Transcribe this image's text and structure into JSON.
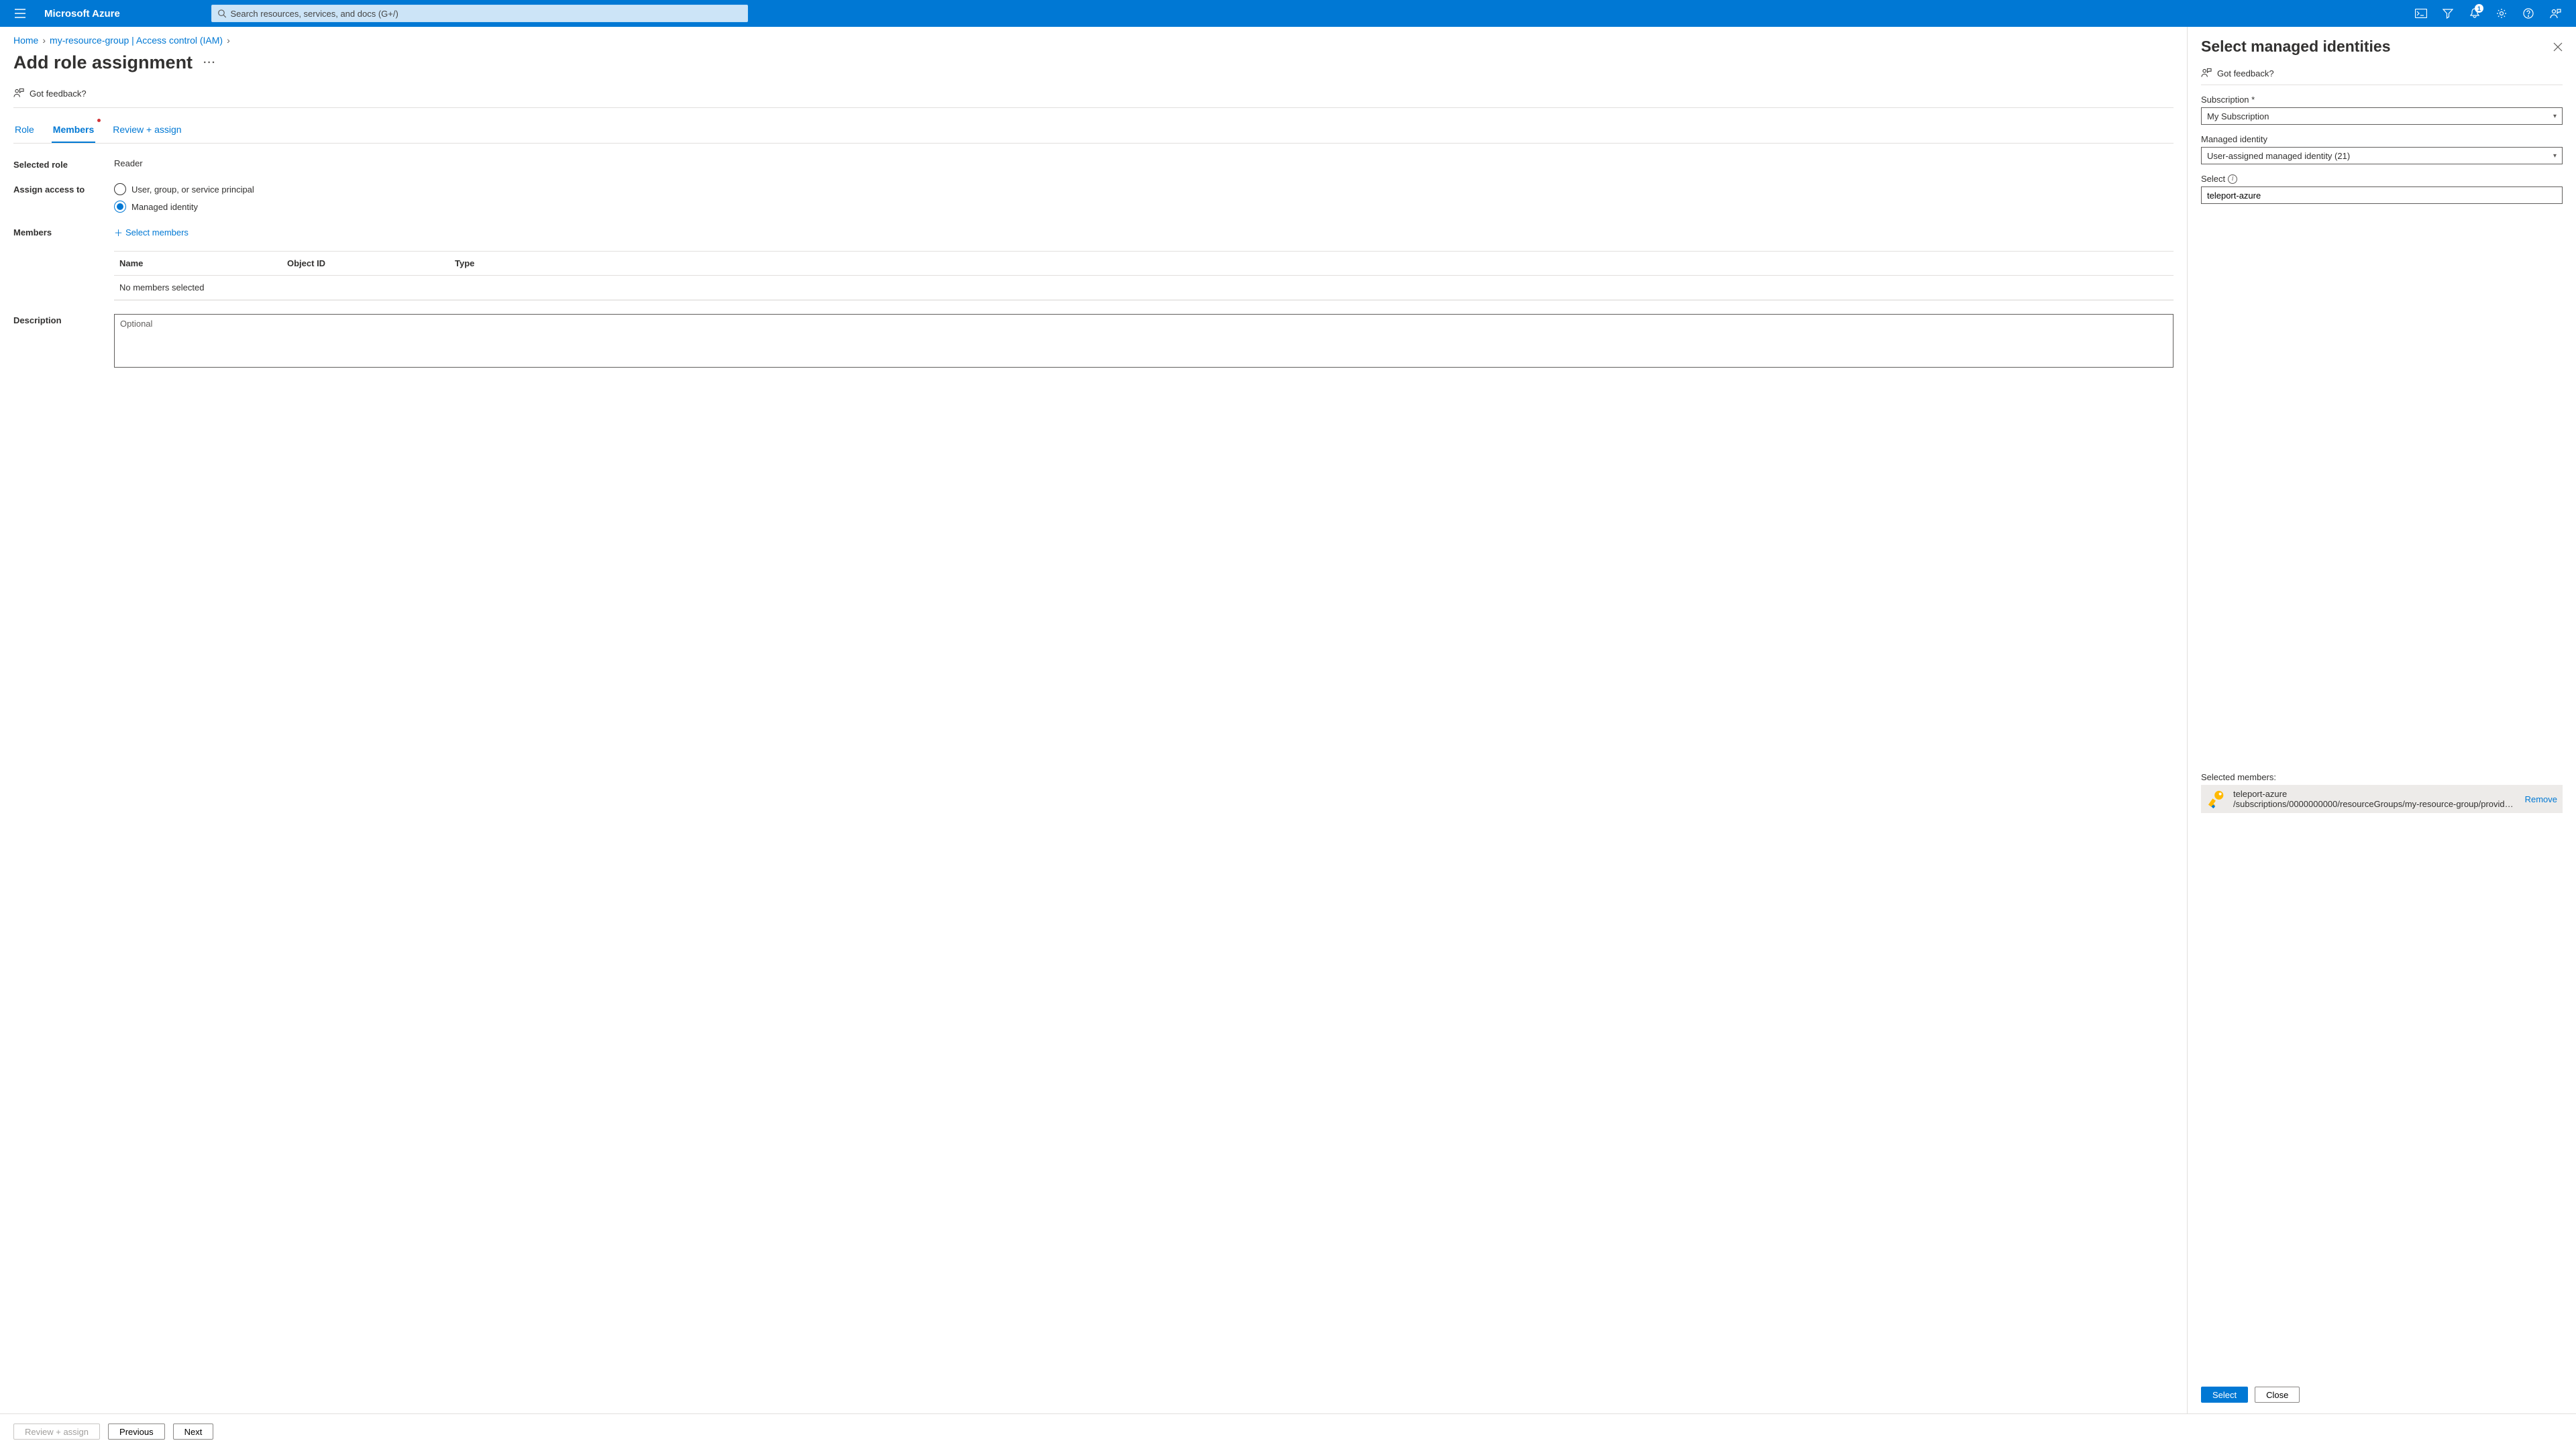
{
  "header": {
    "brand": "Microsoft Azure",
    "search_placeholder": "Search resources, services, and docs (G+/)",
    "notification_count": "1"
  },
  "breadcrumb": {
    "items": [
      "Home",
      "my-resource-group | Access control (IAM)"
    ]
  },
  "page": {
    "title": "Add role assignment",
    "feedback_label": "Got feedback?"
  },
  "tabs": {
    "items": [
      {
        "label": "Role",
        "active": false
      },
      {
        "label": "Members",
        "active": true
      },
      {
        "label": "Review + assign",
        "active": false
      }
    ]
  },
  "form": {
    "selected_role_label": "Selected role",
    "selected_role_value": "Reader",
    "assign_access_label": "Assign access to",
    "radio_user": "User, group, or service principal",
    "radio_managed": "Managed identity",
    "members_label": "Members",
    "select_members_label": "Select members",
    "table": {
      "col_name": "Name",
      "col_obj": "Object ID",
      "col_type": "Type",
      "empty": "No members selected"
    },
    "description_label": "Description",
    "description_placeholder": "Optional"
  },
  "footer": {
    "review": "Review + assign",
    "previous": "Previous",
    "next": "Next"
  },
  "panel": {
    "title": "Select managed identities",
    "feedback_label": "Got feedback?",
    "subscription_label": "Subscription *",
    "subscription_value": "My Subscription",
    "managed_label": "Managed identity",
    "managed_value": "User-assigned managed identity (21)",
    "select_label": "Select",
    "select_value": "teleport-azure",
    "selected_members_label": "Selected members:",
    "selected_name": "teleport-azure",
    "selected_path": "/subscriptions/0000000000/resourceGroups/my-resource-group/providers…",
    "remove_label": "Remove",
    "select_btn": "Select",
    "close_btn": "Close"
  }
}
